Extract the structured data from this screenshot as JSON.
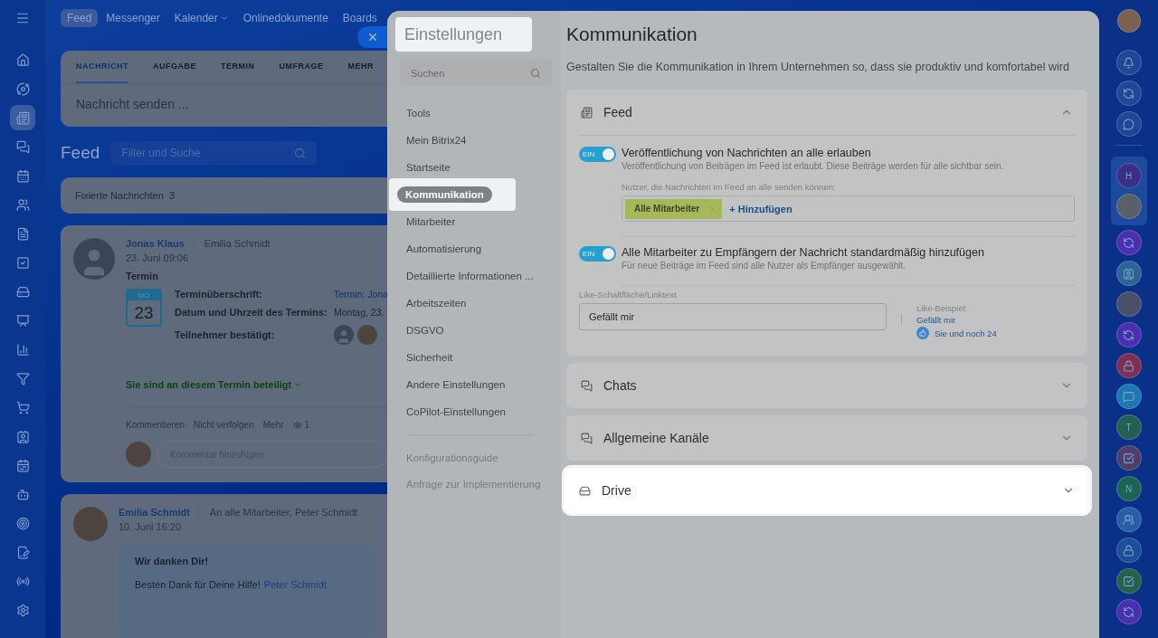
{
  "left_nav": [
    {
      "selected": false
    },
    {
      "selected": false
    },
    {
      "selected": true
    },
    {
      "selected": false
    },
    {
      "selected": false
    },
    {
      "selected": false
    },
    {
      "selected": false
    },
    {
      "selected": false
    },
    {
      "selected": false
    },
    {
      "selected": false
    },
    {
      "selected": false
    },
    {
      "selected": false
    },
    {
      "selected": false
    },
    {
      "selected": false
    },
    {
      "selected": false
    },
    {
      "selected": false
    },
    {
      "selected": false
    },
    {
      "selected": false
    },
    {
      "selected": false
    },
    {
      "selected": false
    }
  ],
  "top_nav": [
    {
      "label": "Feed",
      "selected": true,
      "has_menu": false
    },
    {
      "label": "Messenger",
      "selected": false,
      "has_menu": false
    },
    {
      "label": "Kalender",
      "selected": false,
      "has_menu": true
    },
    {
      "label": "Onlinedokumente",
      "selected": false,
      "has_menu": false
    },
    {
      "label": "Boards",
      "selected": false,
      "has_menu": false
    }
  ],
  "composer": {
    "tabs": [
      {
        "label": "NACHRICHT",
        "selected": true
      },
      {
        "label": "AUFGABE",
        "selected": false
      },
      {
        "label": "TERMIN",
        "selected": false
      },
      {
        "label": "UMFRAGE",
        "selected": false
      },
      {
        "label": "MEHR",
        "selected": false
      }
    ],
    "placeholder": "Nachricht senden ..."
  },
  "feed_header": {
    "title": "Feed",
    "filter_placeholder": "Filter und Suche"
  },
  "pinned": {
    "label": "Fixierte Nachrichten",
    "count": "3"
  },
  "posts": [
    {
      "kind": "event",
      "author": "Jonas Klaus",
      "recipient": "Emilia Schmidt",
      "date": "23. Juni 09:06",
      "title": "Termin",
      "day_abbr": "MO",
      "day": "23",
      "fields": [
        {
          "label": "Terminüberschrift:",
          "value": "Termin: Jona",
          "link": true
        },
        {
          "label": "Datum und Uhrzeit des Termins:",
          "value": "Montag, 23.",
          "link": false
        },
        {
          "label": "Teilnehmer bestätigt:"
        }
      ],
      "status": "Sie sind an diesem Termin beteiligt",
      "actions": [
        "Kommentieren",
        "Nicht verfolgen",
        "Mehr"
      ],
      "views": "1",
      "comment_placeholder": "Kommentar hinzufügen"
    },
    {
      "kind": "message",
      "author": "Emilia Schmidt",
      "recipient": "An alle Mitarbeiter, Peter Schmidt",
      "date": "10. Juni 16:20",
      "title": "Wir danken Dir!",
      "text": "Besten Dank für Deine Hilfe!",
      "mention": "Peter Schmidt"
    }
  ],
  "settings": {
    "title": "Einstellungen",
    "title_highlighted": true,
    "search_placeholder": "Suchen",
    "menu": [
      {
        "label": "Tools",
        "selected": false
      },
      {
        "label": "Mein Bitrix24",
        "selected": false
      },
      {
        "label": "Startseite",
        "selected": false
      },
      {
        "label": "Kommunikation",
        "selected": true
      },
      {
        "label": "Mitarbeiter",
        "selected": false
      },
      {
        "label": "Automatisierung",
        "selected": false
      },
      {
        "label": "Detaillierte Informationen ...",
        "selected": false
      },
      {
        "label": "Arbeitszeiten",
        "selected": false
      },
      {
        "label": "DSGVO",
        "selected": false
      },
      {
        "label": "Sicherheit",
        "selected": false
      },
      {
        "label": "Andere Einstellungen",
        "selected": false
      },
      {
        "label": "CoPilot-Einstellungen",
        "selected": false
      }
    ],
    "footer_links": [
      "Konfigurationsguide",
      "Anfrage zur Implementierung"
    ],
    "heading": "Kommunikation",
    "subtitle": "Gestalten Sie die Kommunikation in Ihrem Unternehmen so, dass sie produktiv und komfortabel wird",
    "sections": [
      {
        "kind": "feed",
        "title": "Feed",
        "expanded": true,
        "highlighted": false,
        "toggles": [
          {
            "label": "Veröffentlichung von Nachrichten an alle erlauben",
            "hint": "Veröffentlichung von Beiträgen im Feed ist erlaubt. Diese Beiträge werden für alle sichtbar sein.",
            "on": true,
            "state_label": "EIN",
            "users_label": "Nutzer, die Nachrichten im Feed an alle senden können:",
            "tags": [
              "Alle Mitarbeiter"
            ],
            "add_label": "+ Hinzufügen"
          },
          {
            "label": "Alle Mitarbeiter zu Empfängern der Nachricht standardmäßig hinzufügen",
            "hint": "Für neue Beiträge im Feed sind alle Nutzer als Empfänger ausgewählt.",
            "on": true,
            "state_label": "EIN"
          }
        ],
        "like_label": "Like-Schaltfläche/Linktext",
        "like_value": "Gefällt mir",
        "example_label": "Like-Beispiel:",
        "example_link": "Gefällt mir",
        "example_text": "Sie und noch 24"
      },
      {
        "kind": "chats",
        "title": "Chats",
        "expanded": false,
        "highlighted": false
      },
      {
        "kind": "channels",
        "title": "Allgemeine Kanäle",
        "expanded": false,
        "highlighted": false
      },
      {
        "kind": "drive",
        "title": "Drive",
        "expanded": false,
        "highlighted": true
      }
    ]
  },
  "right_bar": {
    "pinned": [
      {
        "kind": "letter",
        "text": "H",
        "color": "#3b2f86"
      },
      {
        "kind": "avatar",
        "color": "#5b5f6a"
      }
    ],
    "recent": [
      {
        "kind": "copilot",
        "color": "#4a2fb0"
      },
      {
        "kind": "card",
        "color": "#2d6496"
      },
      {
        "kind": "avatar",
        "color": "#4a4f6a"
      },
      {
        "kind": "copilot",
        "color": "#4a2fb0"
      },
      {
        "kind": "lock",
        "color": "#7e2f52"
      },
      {
        "kind": "chat",
        "color": "#1e78b0"
      },
      {
        "kind": "letter",
        "text": "T",
        "color": "#235f55"
      },
      {
        "kind": "task",
        "color": "#4d3f6a"
      },
      {
        "kind": "letter",
        "text": "N",
        "color": "#1d6456"
      },
      {
        "kind": "people",
        "color": "#275ea8"
      },
      {
        "kind": "lock",
        "color": "#1d4e9a"
      },
      {
        "kind": "task",
        "color": "#25604a"
      },
      {
        "kind": "copilot",
        "color": "#4a2fb0"
      }
    ]
  }
}
